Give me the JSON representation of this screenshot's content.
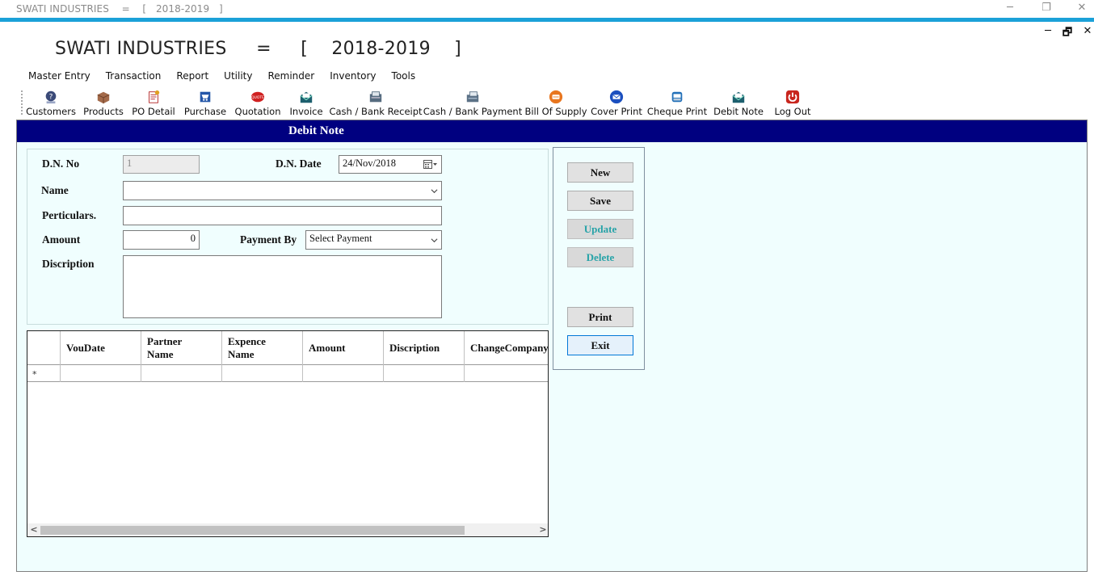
{
  "window": {
    "title": "SWATI INDUSTRIES    =    [   2018-2019   ]",
    "minimize": "─",
    "restore": "❐",
    "close": "✕",
    "mdi_minimize": "─",
    "mdi_restore": "🗗",
    "mdi_close": "✕"
  },
  "app": {
    "company_line": "SWATI INDUSTRIES     =     [    2018-2019    ]"
  },
  "menu": [
    "Master Entry",
    "Transaction",
    "Report",
    "Utility",
    "Reminder",
    "Inventory",
    "Tools"
  ],
  "toolbar": [
    {
      "label": "Customers",
      "icon": "customers-icon"
    },
    {
      "label": "Products",
      "icon": "products-icon"
    },
    {
      "label": "PO Detail",
      "icon": "po-detail-icon"
    },
    {
      "label": "Purchase",
      "icon": "purchase-icon"
    },
    {
      "label": "Quotation",
      "icon": "quotation-icon"
    },
    {
      "label": "Invoice",
      "icon": "invoice-icon"
    },
    {
      "label": "Cash / Bank Receipt",
      "icon": "cash-bank-receipt-icon"
    },
    {
      "label": "Cash / Bank Payment",
      "icon": "cash-bank-payment-icon"
    },
    {
      "label": "Bill Of Supply",
      "icon": "bill-of-supply-icon"
    },
    {
      "label": "Cover Print",
      "icon": "cover-print-icon"
    },
    {
      "label": "Cheque Print",
      "icon": "cheque-print-icon"
    },
    {
      "label": "Debit Note",
      "icon": "debit-note-icon"
    },
    {
      "label": "Log Out",
      "icon": "log-out-icon"
    }
  ],
  "form": {
    "title": "Debit Note",
    "dn_no_label": "D.N. No",
    "dn_no_value": "1",
    "dn_date_label": "D.N. Date",
    "dn_date_value": "24/Nov/2018",
    "name_label": "Name",
    "name_value": "",
    "particulars_label": "Perticulars.",
    "particulars_value": "",
    "amount_label": "Amount",
    "amount_value": "0",
    "payment_by_label": "Payment By",
    "payment_by_value": "Select Payment",
    "description_label": "Discription",
    "description_value": ""
  },
  "buttons": {
    "new": "New",
    "save": "Save",
    "update": "Update",
    "delete": "Delete",
    "print": "Print",
    "exit": "Exit"
  },
  "grid": {
    "columns": [
      {
        "line1": "VouDate",
        "line2": ""
      },
      {
        "line1": "Partner",
        "line2": "Name"
      },
      {
        "line1": "Expence",
        "line2": "Name"
      },
      {
        "line1": "Amount",
        "line2": ""
      },
      {
        "line1": "Discription",
        "line2": ""
      },
      {
        "line1": "ChangeCompany",
        "line2": ""
      }
    ],
    "new_row_marker": "*",
    "scroll_left": "<",
    "scroll_right": ">"
  },
  "colors": {
    "accent_bar": "#1ba1d8",
    "header_bg": "#000080",
    "panel_bg": "#f0fefe",
    "disabled_text": "#27a3a8"
  }
}
